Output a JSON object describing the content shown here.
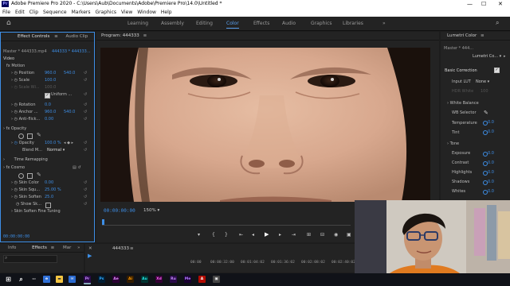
{
  "window": {
    "title": "Adobe Premiere Pro 2020 - C:\\Users\\Aub\\Documents\\Adobe\\Premiere Pro\\14.0\\Untitled *",
    "app_badge": "Pr"
  },
  "menu": [
    "File",
    "Edit",
    "Clip",
    "Sequence",
    "Markers",
    "Graphics",
    "View",
    "Window",
    "Help"
  ],
  "workspaces": {
    "items": [
      "Learning",
      "Assembly",
      "Editing",
      "Color",
      "Effects",
      "Audio",
      "Graphics",
      "Libraries"
    ],
    "active": "Color",
    "overflow": "»"
  },
  "effect_controls": {
    "tabs": [
      "Effect Controls",
      "Audio Clip"
    ],
    "master_label": "Master * 444333.mp4",
    "clip_label": "444333 * 444333...",
    "section_video": "Video",
    "motion": {
      "label": "Motion",
      "rows": [
        {
          "name": "Position",
          "value": "960.0",
          "value2": "540.0"
        },
        {
          "name": "Scale",
          "value": "100.0",
          "value2": ""
        },
        {
          "name": "Scale Wi...",
          "value": "100.0",
          "value2": ""
        },
        {
          "name": "Uniform ...",
          "value": "",
          "value2": ""
        },
        {
          "name": "Rotation",
          "value": "0.0",
          "value2": ""
        },
        {
          "name": "Anchor ...",
          "value": "960.0",
          "value2": "540.0"
        },
        {
          "name": "Anti-flick...",
          "value": "0.00",
          "value2": ""
        }
      ]
    },
    "opacity": {
      "label": "Opacity",
      "value": "100.0 %",
      "blend_label": "Blend M...",
      "blend_value": "Normal"
    },
    "time_remapping": "Time Remapping",
    "cosmo": {
      "label": "Cosmo",
      "rows": [
        {
          "name": "Skin Color",
          "value": "0.00"
        },
        {
          "name": "Skin Squ...",
          "value": "25.00 %"
        },
        {
          "name": "Skin Soften",
          "value": "25.0"
        },
        {
          "name": "Show Sk...",
          "value": ""
        },
        {
          "name": "Skin Soften Fine Tuning",
          "value": ""
        }
      ]
    },
    "timecode": "00:00:00:00"
  },
  "effects_panel": {
    "tabs": [
      "Info",
      "Effects",
      "Mar"
    ],
    "search_placeholder": ""
  },
  "program_monitor": {
    "title": "Program: 444333",
    "timecode": "00:00:00:00",
    "zoom": "150%"
  },
  "timeline": {
    "sequence_name": "444333",
    "ruler": [
      "00:00",
      "00:00:32:00",
      "00:01:04:02",
      "00:01:36:02",
      "00:02:08:02",
      "00:02:40:02"
    ]
  },
  "lumetri": {
    "title": "Lumetri Color",
    "master_label": "Master * 444...",
    "clip_label": "Lumetri Co...",
    "basic_correction": "Basic Correction",
    "input_lut_label": "Input LUT",
    "input_lut_value": "None",
    "hdr_white": "HDR White",
    "hdr_white_value": "100",
    "white_balance": "White Balance",
    "wb_selector": "WB Selector",
    "temperature": {
      "label": "Temperature",
      "value": "0.0"
    },
    "tint": {
      "label": "Tint",
      "value": "0.0"
    },
    "tone": "Tone",
    "tone_rows": [
      {
        "label": "Exposure",
        "value": "0.0"
      },
      {
        "label": "Contrast",
        "value": "0.0"
      },
      {
        "label": "Highlights",
        "value": "0.0"
      },
      {
        "label": "Shadows",
        "value": "0.0"
      },
      {
        "label": "Whites",
        "value": "0.0"
      }
    ]
  },
  "colors": {
    "accent": "#3d8ee6",
    "panel": "#232323",
    "background": "#1d1d1d"
  }
}
